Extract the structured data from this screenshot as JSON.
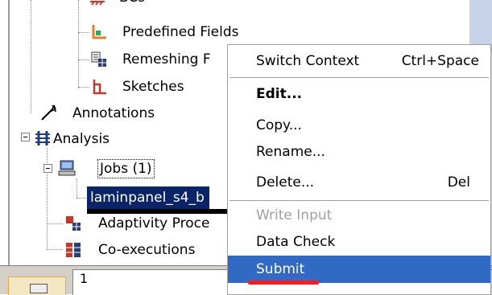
{
  "tree": {
    "items": [
      {
        "label": "BCs",
        "icon": "bcs-icon"
      },
      {
        "label": "Predefined Fields",
        "icon": "predefined-fields-icon"
      },
      {
        "label": "Remeshing Rules",
        "visible_label": "Remeshing F",
        "icon": "remeshing-icon"
      },
      {
        "label": "Sketches",
        "icon": "sketch-icon"
      },
      {
        "label": "Annotations",
        "icon": "annotation-icon"
      },
      {
        "label": "Analysis",
        "icon": "analysis-icon"
      },
      {
        "label": "Jobs (1)",
        "icon": "computer-icon"
      },
      {
        "label": "laminpanel_s4_b",
        "icon": ""
      },
      {
        "label": "Adaptivity Proce",
        "icon": "adaptivity-icon"
      },
      {
        "label": "Co-executions",
        "icon": "co-execution-icon"
      }
    ]
  },
  "bottom": {
    "field_value": "1"
  },
  "context_menu": {
    "items": [
      {
        "label": "Switch Context",
        "shortcut": "Ctrl+Space"
      },
      {
        "label": "Edit...",
        "shortcut": ""
      },
      {
        "label": "Copy...",
        "shortcut": ""
      },
      {
        "label": "Rename...",
        "shortcut": ""
      },
      {
        "label": "Delete...",
        "shortcut": "Del"
      },
      {
        "label": "Write Input",
        "shortcut": ""
      },
      {
        "label": "Data Check",
        "shortcut": ""
      },
      {
        "label": "Submit",
        "shortcut": ""
      }
    ]
  },
  "colors": {
    "selection": "#0a246a",
    "menu_highlight": "#316ac5",
    "annotation_underline": "#ff1a1a"
  }
}
